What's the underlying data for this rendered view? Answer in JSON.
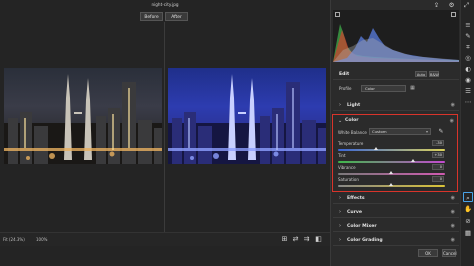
{
  "window": {
    "file_title": "night-city.jpg",
    "tab_before": "Before",
    "tab_after": "After",
    "icons": [
      "export-icon",
      "settings-icon",
      "expand-icon"
    ]
  },
  "bottom_bar": {
    "fit": "Fit (24.3%)",
    "zoom": "100%",
    "icons": [
      "cycle-view-icon",
      "swap-icon",
      "copy-settings-icon",
      "toggle-preview-icon"
    ]
  },
  "panel": {
    "edit_title": "Edit",
    "auto_label": "Auto",
    "bw_label": "B&W",
    "profile_label": "Profile",
    "profile_value": "Color",
    "sections": {
      "light": "Light",
      "color": "Color",
      "effects": "Effects",
      "curve": "Curve",
      "color_mixer": "Color Mixer",
      "color_grading": "Color Grading"
    },
    "white_balance_label": "White Balance",
    "white_balance_value": "Custom",
    "sliders": [
      {
        "label": "Temperature",
        "value": "-30",
        "position": 0.36
      },
      {
        "label": "Tint",
        "value": "+30",
        "position": 0.7
      },
      {
        "label": "Vibrance",
        "value": "0",
        "position": 0.5
      },
      {
        "label": "Saturation",
        "value": "0",
        "position": 0.5
      }
    ],
    "ok_label": "OK",
    "cancel_label": "Cancel"
  },
  "toolbar": {
    "tools": [
      "edit-sliders-icon",
      "brush-icon",
      "crop-icon",
      "heal-icon",
      "mask-icon",
      "red-eye-icon",
      "presets-icon",
      "more-icon",
      "zoom-icon",
      "hand-icon",
      "eyedropper-icon",
      "grid-icon"
    ]
  },
  "colors": {
    "highlight": "#d9342b",
    "panel_bg": "#2b2b2b",
    "canvas_bg": "#242424"
  }
}
